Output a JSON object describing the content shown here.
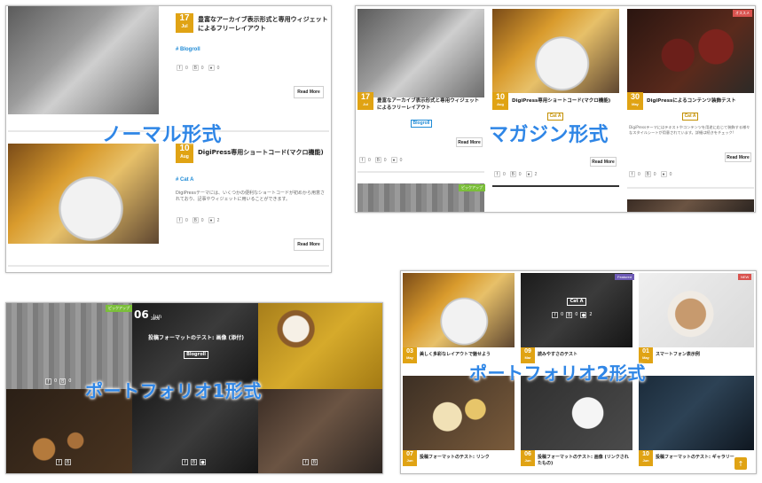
{
  "labels": {
    "normal": "ノーマル形式",
    "magazine": "マガジン形式",
    "portfolio1": "ポートフォリオ1形式",
    "portfolio2": "ポートフォリオ2形式"
  },
  "normal": {
    "posts": [
      {
        "day": "17",
        "month": "Jul",
        "title": "豊富なアーカイブ表示形式と専用ウィジェットによるフリーレイアウト",
        "category": "# Blogroll",
        "share_counts": [
          "0",
          "0",
          "0"
        ],
        "more": "Read More"
      },
      {
        "day": "10",
        "month": "Aug",
        "title": "DigiPress専用ショートコード(マクロ機能)",
        "category": "# Cat A",
        "excerpt": "DigiPressテーマには、いくつかの便利なショートコードが初めから用意されており、記事やウィジェットに用いることができます。",
        "share_counts": [
          "0",
          "0",
          "2"
        ],
        "more": "Read More"
      }
    ]
  },
  "magazine": {
    "tag_top_right": "オススメ",
    "tag_bottom": "ピックアップ",
    "posts": [
      {
        "day": "17",
        "month": "Jul",
        "title": "豊富なアーカイブ表示形式と専用ウィジェットによるフリーレイアウト",
        "category": "Blogroll",
        "share_counts": [
          "0",
          "0",
          "0"
        ],
        "more": "Read More"
      },
      {
        "day": "10",
        "month": "Aug",
        "title": "DigiPress専用ショートコード(マクロ機能)",
        "category": "Cat A",
        "share_counts": [
          "0",
          "0",
          "2"
        ],
        "more": "Read More"
      },
      {
        "day": "30",
        "month": "May",
        "title": "DigiPressによるコンテンツ装飾テスト",
        "category": "Cat A",
        "excerpt": "DigiPressテーマにはテキストやコンテンツを用途に応じて装飾する様々なスタイルシートが用意されています。詳細は続きをチェック!",
        "share_counts": [
          "0",
          "0",
          "0"
        ],
        "more": "Read More"
      }
    ]
  },
  "portfolio1": {
    "tag": "ピックアップ",
    "center_day": "06",
    "center_month": "Jun",
    "center_year": "2006",
    "center_title": "投稿フォーマットのテスト: 画像 (添付)",
    "center_category": "Blogroll",
    "share_counts": [
      "0",
      "0",
      "0"
    ]
  },
  "portfolio2": {
    "tag_featured": "Featured",
    "tag_new": "NEW",
    "hover_category": "Cat A",
    "hover_share_counts": [
      "0",
      "0",
      "2"
    ],
    "posts": [
      {
        "day": "03",
        "month": "May",
        "title": "美しく多彩なレイアウトで魅せよう"
      },
      {
        "day": "09",
        "month": "Mar",
        "title": "読みやすさのテスト"
      },
      {
        "day": "01",
        "month": "May",
        "title": "スマートフォン表示例"
      },
      {
        "day": "07",
        "month": "Jun",
        "title": "投稿フォーマットのテスト: リンク"
      },
      {
        "day": "06",
        "month": "Jun",
        "title": "投稿フォーマットのテスト: 画像 (リンクされたもの)"
      },
      {
        "day": "10",
        "month": "Jun",
        "title": "投稿フォーマットのテスト: ギャラリー"
      }
    ],
    "up_icon": "arrow-up-icon"
  },
  "colors": {
    "accent_gold": "#e0a314",
    "label_blue": "#2f86e6",
    "category_blue": "#1f8bd6"
  }
}
